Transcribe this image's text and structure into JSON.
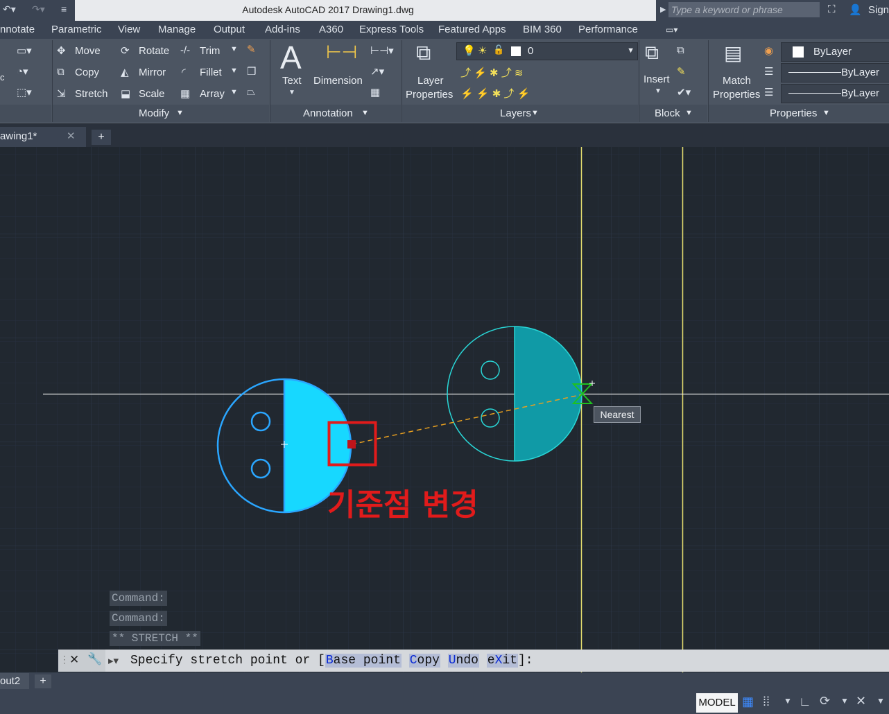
{
  "titlebar": {
    "app_title": "Autodesk AutoCAD 2017     Drawing1.dwg",
    "search_placeholder": "Type a keyword or phrase",
    "sign_in": "Sign"
  },
  "ribbon_tabs": [
    "nnotate",
    "Parametric",
    "View",
    "Manage",
    "Output",
    "Add-ins",
    "A360",
    "Express Tools",
    "Featured Apps",
    "BIM 360",
    "Performance"
  ],
  "modify": {
    "move": "Move",
    "rotate": "Rotate",
    "trim": "Trim",
    "copy": "Copy",
    "mirror": "Mirror",
    "fillet": "Fillet",
    "stretch": "Stretch",
    "scale": "Scale",
    "array": "Array",
    "panel": "Modify"
  },
  "annotation": {
    "text": "Text",
    "dimension": "Dimension",
    "panel": "Annotation"
  },
  "layers": {
    "layer_properties_1": "Layer",
    "layer_properties_2": "Properties",
    "current_layer": "0",
    "panel": "Layers"
  },
  "block": {
    "insert": "Insert",
    "panel": "Block"
  },
  "properties": {
    "match_1": "Match",
    "match_2": "Properties",
    "color": "ByLayer",
    "linetype": "ByLayer",
    "lineweight": "ByLayer",
    "panel": "Properties"
  },
  "doc_tabs": {
    "drawing": "awing1*"
  },
  "canvas": {
    "tooltip": "Nearest",
    "annotation": "기준점 변경"
  },
  "command_history": [
    "Command:",
    "Command:",
    "** STRETCH **"
  ],
  "command_line": {
    "prompt": "Specify stretch point or [",
    "options": [
      {
        "key": "B",
        "rest": "ase point"
      },
      {
        "key": "C",
        "rest": "opy"
      },
      {
        "key": "U",
        "rest": "ndo"
      },
      {
        "key": "eX",
        "rest": "it"
      }
    ],
    "suffix": "]:"
  },
  "layout_tabs": {
    "layout": "out2"
  },
  "status": {
    "model": "MODEL"
  },
  "colors": {
    "canvas_bg": "#212830",
    "selected_fill": "#17d8ff",
    "preview_fill": "#109aa6",
    "crosshair_yellow": "#e8e070",
    "highlight_red": "#e11b1b"
  }
}
